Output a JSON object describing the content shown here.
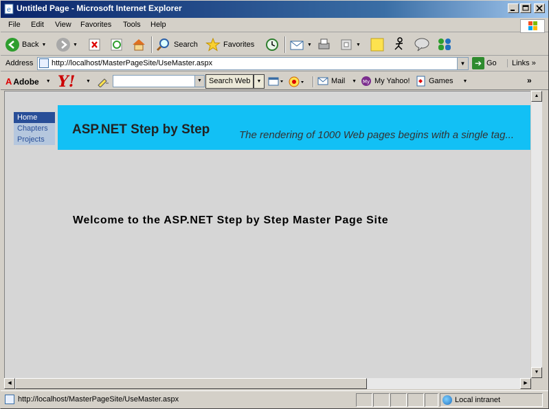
{
  "window": {
    "title": "Untitled Page - Microsoft Internet Explorer",
    "controls": {
      "minimize": "minimize-icon",
      "maximize": "maximize-icon",
      "close": "close-icon"
    }
  },
  "menu": [
    "File",
    "Edit",
    "View",
    "Favorites",
    "Tools",
    "Help"
  ],
  "toolbar": {
    "back_label": "Back",
    "search_label": "Search",
    "favorites_label": "Favorites"
  },
  "address": {
    "label": "Address",
    "url": "http://localhost/MasterPageSite/UseMaster.aspx",
    "go_label": "Go",
    "links_label": "Links"
  },
  "yahoo_toolbar": {
    "adobe_label": "Adobe",
    "yahoo_logo": "Y!",
    "search_value": "",
    "search_web_label": "Search Web",
    "mail_label": "Mail",
    "my_yahoo_label": "My Yahoo!",
    "games_label": "Games"
  },
  "page": {
    "nav": [
      "Home",
      "Chapters",
      "Projects"
    ],
    "active_nav": "Home",
    "banner_title": "ASP.NET Step by Step",
    "banner_tagline": "The rendering of 1000 Web pages begins with a single tag...",
    "welcome": "Welcome to the ASP.NET Step by Step Master Page Site"
  },
  "statusbar": {
    "text": "http://localhost/MasterPageSite/UseMaster.aspx",
    "zone": "Local intranet"
  },
  "colors": {
    "banner": "#12c0f5",
    "nav_active": "#284e98",
    "nav_inactive": "#b5c7de",
    "content_bg": "#d6d6d6"
  }
}
